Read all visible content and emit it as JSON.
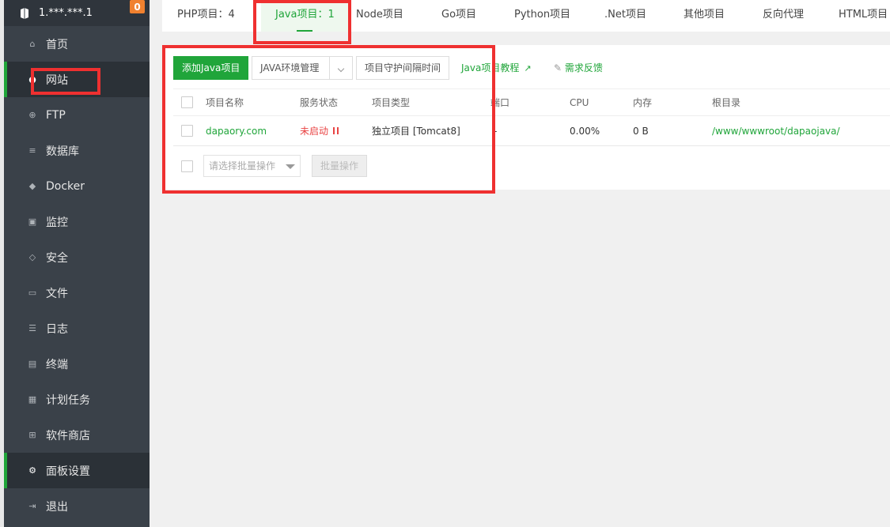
{
  "sidebar": {
    "server_name": "1.***.***.1",
    "badge_count": "0",
    "items": [
      {
        "label": "首页",
        "icon": "home-icon"
      },
      {
        "label": "网站",
        "icon": "globe-icon"
      },
      {
        "label": "FTP",
        "icon": "ftp-globe-icon"
      },
      {
        "label": "数据库",
        "icon": "database-icon"
      },
      {
        "label": "Docker",
        "icon": "docker-icon"
      },
      {
        "label": "监控",
        "icon": "monitor-icon"
      },
      {
        "label": "安全",
        "icon": "shield-icon"
      },
      {
        "label": "文件",
        "icon": "folder-icon"
      },
      {
        "label": "日志",
        "icon": "log-icon"
      },
      {
        "label": "终端",
        "icon": "terminal-icon"
      },
      {
        "label": "计划任务",
        "icon": "calendar-icon"
      },
      {
        "label": "软件商店",
        "icon": "apps-icon"
      },
      {
        "label": "面板设置",
        "icon": "gear-icon"
      },
      {
        "label": "退出",
        "icon": "logout-icon"
      }
    ]
  },
  "tabs": [
    {
      "label": "PHP项目：4"
    },
    {
      "label": "Java项目：1"
    },
    {
      "label": "Node项目"
    },
    {
      "label": "Go项目"
    },
    {
      "label": "Python项目"
    },
    {
      "label": ".Net项目"
    },
    {
      "label": "其他项目"
    },
    {
      "label": "反向代理"
    },
    {
      "label": "HTML项目"
    }
  ],
  "toolbar": {
    "add_button": "添加Java项目",
    "env_button": "JAVA环境管理",
    "daemon_button": "项目守护间隔时间",
    "tutorial_link": "Java项目教程",
    "feedback_link": "需求反馈"
  },
  "table": {
    "headers": [
      "项目名称",
      "服务状态",
      "项目类型",
      "端口",
      "CPU",
      "内存",
      "根目录"
    ],
    "rows": [
      {
        "name": "dapaory.com",
        "status": "未启动",
        "type": "独立项目 [Tomcat8]",
        "port": "-",
        "cpu": "0.00%",
        "memory": "0 B",
        "root": "/www/wwwroot/dapaojava/"
      }
    ]
  },
  "batch": {
    "select_placeholder": "请选择批量操作",
    "button": "批量操作"
  },
  "colors": {
    "accent": "#20a53a",
    "sidebar_bg": "#3a4149",
    "annotation_red": "#ef3030",
    "status_red": "#e94444"
  }
}
